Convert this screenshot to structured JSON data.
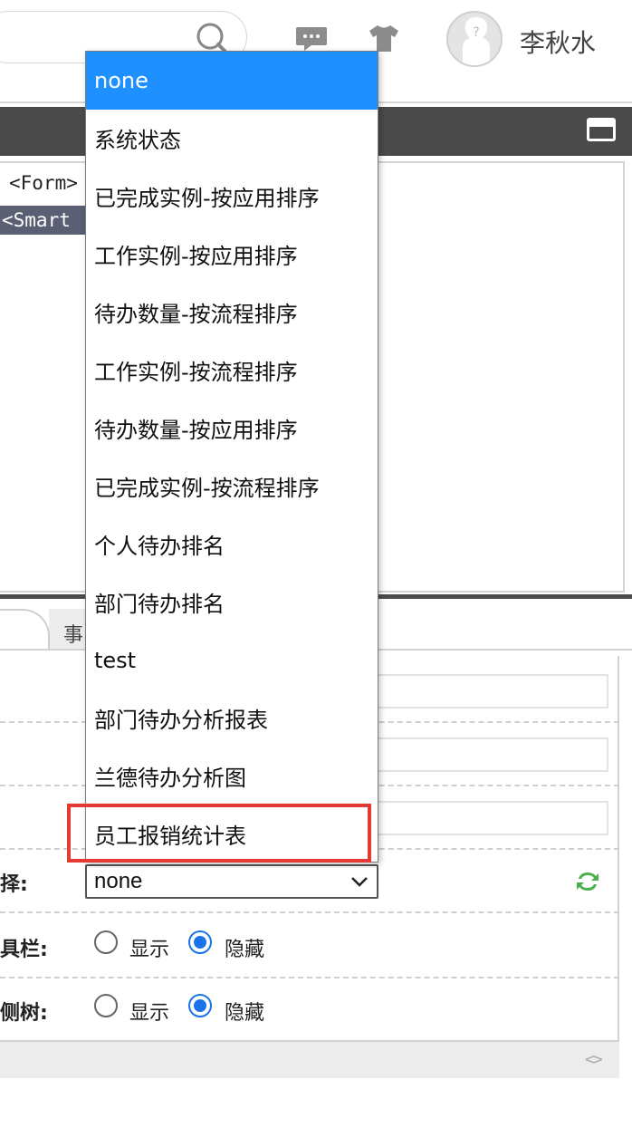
{
  "header": {
    "user_name": "李秋水"
  },
  "editor": {
    "code_lines": [
      "<Form>",
      "<Smart"
    ]
  },
  "tabs": {
    "other_label": "事"
  },
  "form": {
    "select_label": "选择:",
    "select_value": "none",
    "toolbar_label": "工具栏:",
    "sidebar_label": "左侧树:",
    "show_label": "显示",
    "hide_label": "隐藏",
    "toolbar_choice": "隐藏",
    "sidebar_choice": "隐藏"
  },
  "dropdown": {
    "selected": "none",
    "highlighted": "员工报销统计表",
    "options": [
      "none",
      "系统状态",
      "已完成实例-按应用排序",
      "工作实例-按应用排序",
      "待办数量-按流程排序",
      "工作实例-按流程排序",
      "待办数量-按应用排序",
      "已完成实例-按流程排序",
      "个人待办排名",
      "部门待办排名",
      "test",
      "部门待办分析报表",
      "兰德待办分析图",
      "员工报销统计表"
    ]
  },
  "colors": {
    "selected_bg": "#1e90ff",
    "highlight_border": "#e53935",
    "panel_bar": "#4a4a4a",
    "radio_accent": "#1a73e8"
  },
  "icons": {
    "search": "search-icon",
    "message": "message-icon",
    "theme": "shirt-icon",
    "avatar": "user-avatar",
    "maximize": "maximize-icon",
    "refresh": "refresh-icon",
    "chevron": "chevron-down-icon",
    "code": "code-toggle-icon"
  }
}
